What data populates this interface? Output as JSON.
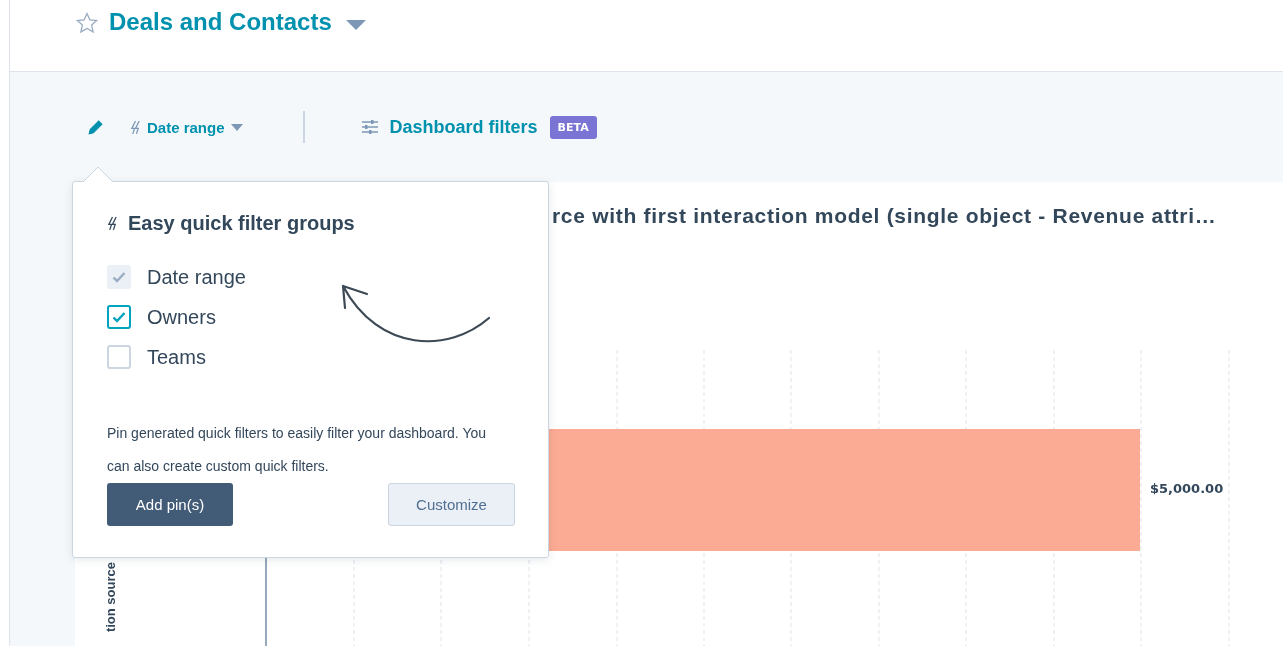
{
  "header": {
    "title": "Deals and Contacts",
    "starred": false
  },
  "toolbar": {
    "quick_filter": "Date range",
    "dashboard_filters": "Dashboard filters",
    "badge": "BETA"
  },
  "popover": {
    "title": "Easy quick filter groups",
    "options": [
      {
        "label": "Date range",
        "checked": true,
        "disabled": true
      },
      {
        "label": "Owners",
        "checked": true,
        "disabled": false
      },
      {
        "label": "Teams",
        "checked": false,
        "disabled": false
      }
    ],
    "description": "Pin generated quick filters to easily filter your dashboard. You can also create custom quick filters.",
    "buttons": [
      "Add pin(s)",
      "Customize"
    ]
  },
  "report": {
    "title": "rce with first interaction model (single object - Revenue attri…",
    "axis_label": "tion source",
    "bar_label": "$5,000.00"
  }
}
